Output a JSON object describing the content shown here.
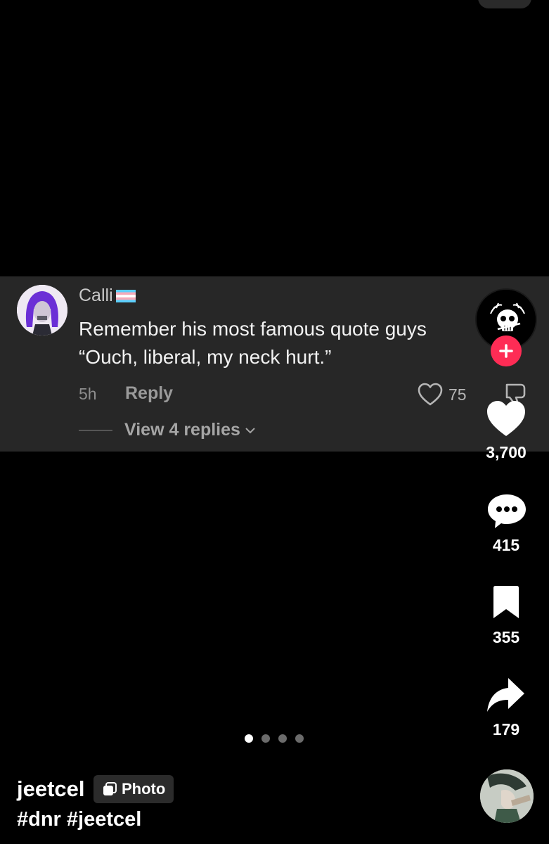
{
  "comment": {
    "username": "Calli",
    "flag_icon": "transgender-flag-emoji",
    "text_line1": "Remember his most famous quote guys",
    "text_line2": "“Ouch, liberal, my neck hurt.”",
    "time": "5h",
    "reply_label": "Reply",
    "like_count": "75",
    "view_replies": "View 4 replies"
  },
  "rail": {
    "likes": "3,700",
    "comments": "415",
    "saves": "355",
    "shares": "179"
  },
  "carousel": {
    "total": 4,
    "active_index": 0
  },
  "post": {
    "author": "jeetcel",
    "badge_label": "Photo",
    "hashtags": "#dnr #jeetcel"
  },
  "colors": {
    "background": "#000000",
    "comment_card": "#272727",
    "follow_red": "#fe2c55",
    "flag_blue": "#5bcefa",
    "flag_pink": "#f5a9b8"
  }
}
